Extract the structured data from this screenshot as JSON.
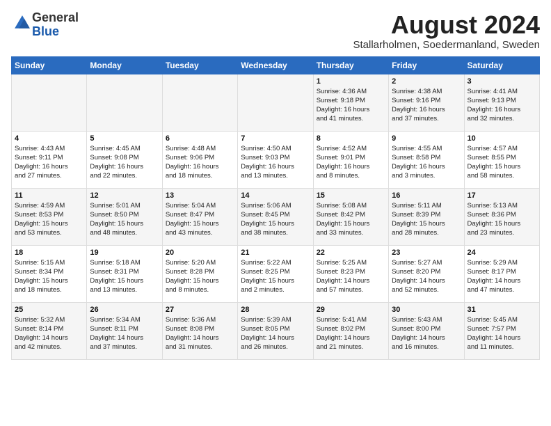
{
  "logo": {
    "general": "General",
    "blue": "Blue"
  },
  "title": "August 2024",
  "location": "Stallarholmen, Soedermanland, Sweden",
  "days_of_week": [
    "Sunday",
    "Monday",
    "Tuesday",
    "Wednesday",
    "Thursday",
    "Friday",
    "Saturday"
  ],
  "weeks": [
    [
      {
        "day": "",
        "info": ""
      },
      {
        "day": "",
        "info": ""
      },
      {
        "day": "",
        "info": ""
      },
      {
        "day": "",
        "info": ""
      },
      {
        "day": "1",
        "info": "Sunrise: 4:36 AM\nSunset: 9:18 PM\nDaylight: 16 hours\nand 41 minutes."
      },
      {
        "day": "2",
        "info": "Sunrise: 4:38 AM\nSunset: 9:16 PM\nDaylight: 16 hours\nand 37 minutes."
      },
      {
        "day": "3",
        "info": "Sunrise: 4:41 AM\nSunset: 9:13 PM\nDaylight: 16 hours\nand 32 minutes."
      }
    ],
    [
      {
        "day": "4",
        "info": "Sunrise: 4:43 AM\nSunset: 9:11 PM\nDaylight: 16 hours\nand 27 minutes."
      },
      {
        "day": "5",
        "info": "Sunrise: 4:45 AM\nSunset: 9:08 PM\nDaylight: 16 hours\nand 22 minutes."
      },
      {
        "day": "6",
        "info": "Sunrise: 4:48 AM\nSunset: 9:06 PM\nDaylight: 16 hours\nand 18 minutes."
      },
      {
        "day": "7",
        "info": "Sunrise: 4:50 AM\nSunset: 9:03 PM\nDaylight: 16 hours\nand 13 minutes."
      },
      {
        "day": "8",
        "info": "Sunrise: 4:52 AM\nSunset: 9:01 PM\nDaylight: 16 hours\nand 8 minutes."
      },
      {
        "day": "9",
        "info": "Sunrise: 4:55 AM\nSunset: 8:58 PM\nDaylight: 16 hours\nand 3 minutes."
      },
      {
        "day": "10",
        "info": "Sunrise: 4:57 AM\nSunset: 8:55 PM\nDaylight: 15 hours\nand 58 minutes."
      }
    ],
    [
      {
        "day": "11",
        "info": "Sunrise: 4:59 AM\nSunset: 8:53 PM\nDaylight: 15 hours\nand 53 minutes."
      },
      {
        "day": "12",
        "info": "Sunrise: 5:01 AM\nSunset: 8:50 PM\nDaylight: 15 hours\nand 48 minutes."
      },
      {
        "day": "13",
        "info": "Sunrise: 5:04 AM\nSunset: 8:47 PM\nDaylight: 15 hours\nand 43 minutes."
      },
      {
        "day": "14",
        "info": "Sunrise: 5:06 AM\nSunset: 8:45 PM\nDaylight: 15 hours\nand 38 minutes."
      },
      {
        "day": "15",
        "info": "Sunrise: 5:08 AM\nSunset: 8:42 PM\nDaylight: 15 hours\nand 33 minutes."
      },
      {
        "day": "16",
        "info": "Sunrise: 5:11 AM\nSunset: 8:39 PM\nDaylight: 15 hours\nand 28 minutes."
      },
      {
        "day": "17",
        "info": "Sunrise: 5:13 AM\nSunset: 8:36 PM\nDaylight: 15 hours\nand 23 minutes."
      }
    ],
    [
      {
        "day": "18",
        "info": "Sunrise: 5:15 AM\nSunset: 8:34 PM\nDaylight: 15 hours\nand 18 minutes."
      },
      {
        "day": "19",
        "info": "Sunrise: 5:18 AM\nSunset: 8:31 PM\nDaylight: 15 hours\nand 13 minutes."
      },
      {
        "day": "20",
        "info": "Sunrise: 5:20 AM\nSunset: 8:28 PM\nDaylight: 15 hours\nand 8 minutes."
      },
      {
        "day": "21",
        "info": "Sunrise: 5:22 AM\nSunset: 8:25 PM\nDaylight: 15 hours\nand 2 minutes."
      },
      {
        "day": "22",
        "info": "Sunrise: 5:25 AM\nSunset: 8:23 PM\nDaylight: 14 hours\nand 57 minutes."
      },
      {
        "day": "23",
        "info": "Sunrise: 5:27 AM\nSunset: 8:20 PM\nDaylight: 14 hours\nand 52 minutes."
      },
      {
        "day": "24",
        "info": "Sunrise: 5:29 AM\nSunset: 8:17 PM\nDaylight: 14 hours\nand 47 minutes."
      }
    ],
    [
      {
        "day": "25",
        "info": "Sunrise: 5:32 AM\nSunset: 8:14 PM\nDaylight: 14 hours\nand 42 minutes."
      },
      {
        "day": "26",
        "info": "Sunrise: 5:34 AM\nSunset: 8:11 PM\nDaylight: 14 hours\nand 37 minutes."
      },
      {
        "day": "27",
        "info": "Sunrise: 5:36 AM\nSunset: 8:08 PM\nDaylight: 14 hours\nand 31 minutes."
      },
      {
        "day": "28",
        "info": "Sunrise: 5:39 AM\nSunset: 8:05 PM\nDaylight: 14 hours\nand 26 minutes."
      },
      {
        "day": "29",
        "info": "Sunrise: 5:41 AM\nSunset: 8:02 PM\nDaylight: 14 hours\nand 21 minutes."
      },
      {
        "day": "30",
        "info": "Sunrise: 5:43 AM\nSunset: 8:00 PM\nDaylight: 14 hours\nand 16 minutes."
      },
      {
        "day": "31",
        "info": "Sunrise: 5:45 AM\nSunset: 7:57 PM\nDaylight: 14 hours\nand 11 minutes."
      }
    ]
  ]
}
